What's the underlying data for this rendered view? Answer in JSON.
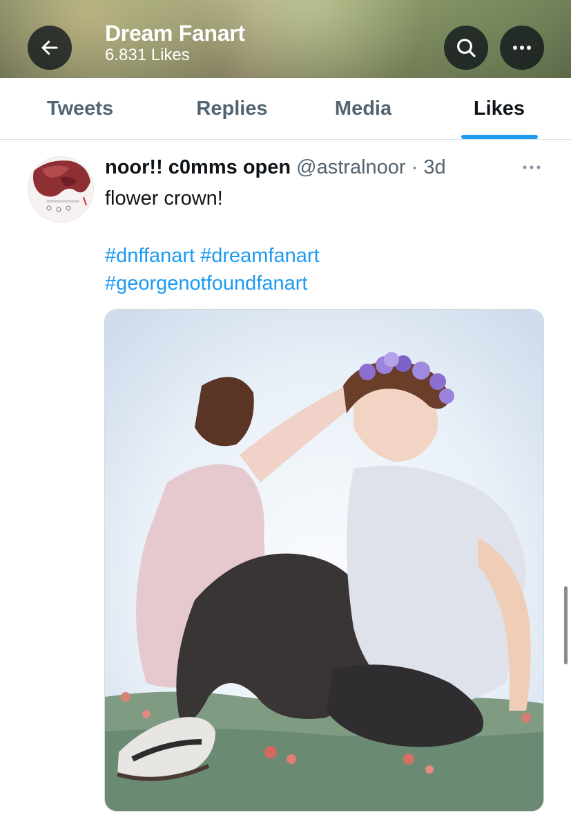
{
  "header": {
    "title": "Dream Fanart",
    "subtitle": "6.831 Likes",
    "back_icon": "arrow-left-icon",
    "search_icon": "search-icon",
    "more_icon": "more-horizontal-icon"
  },
  "tabs": [
    {
      "label": "Tweets",
      "active": false
    },
    {
      "label": "Replies",
      "active": false
    },
    {
      "label": "Media",
      "active": false
    },
    {
      "label": "Likes",
      "active": true
    }
  ],
  "tweet": {
    "display_name": "noor!! c0mms open",
    "handle": "@astralnoor",
    "separator": "·",
    "time": "3d",
    "text": "flower crown!",
    "hashtags_line1": "#dnffanart #dreamfanart",
    "hashtags_line2": "#georgenotfoundfanart",
    "more_icon": "more-horizontal-icon"
  },
  "colors": {
    "accent": "#1d9bf0",
    "text_primary": "#0f1419",
    "text_secondary": "#536471",
    "divider": "#cfd9de"
  }
}
